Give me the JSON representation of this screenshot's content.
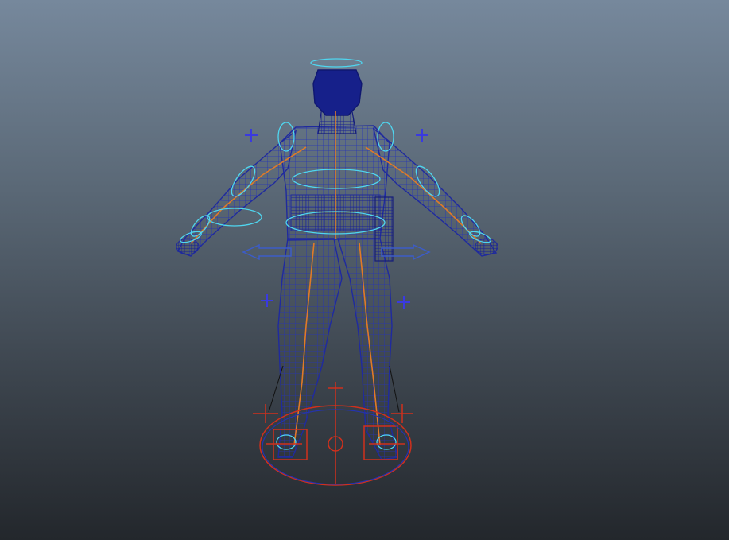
{
  "viewport": {
    "background_top": "#76889c",
    "background_bottom": "#23272c"
  },
  "colors": {
    "mesh": "#1f2a9e",
    "mesh_dense": "#141c7a",
    "fk_control": "#4fd6f0",
    "ik_control": "#d0301c",
    "pole_vector": "#3a3ae0",
    "joint": "#e07a28",
    "move_arrow": "#3c5cc8"
  },
  "rig_controls": [
    "head-halo-control",
    "shoulder-left-control",
    "shoulder-right-control",
    "elbow-left-control",
    "elbow-right-control",
    "wrist-left-control",
    "wrist-right-control",
    "chest-control",
    "hip-control",
    "hip-translate-arrows",
    "arm-pole-vector-left",
    "arm-pole-vector-right",
    "leg-pole-vector-left",
    "leg-pole-vector-right",
    "foot-ik-left",
    "foot-ik-right",
    "root-master-control"
  ]
}
